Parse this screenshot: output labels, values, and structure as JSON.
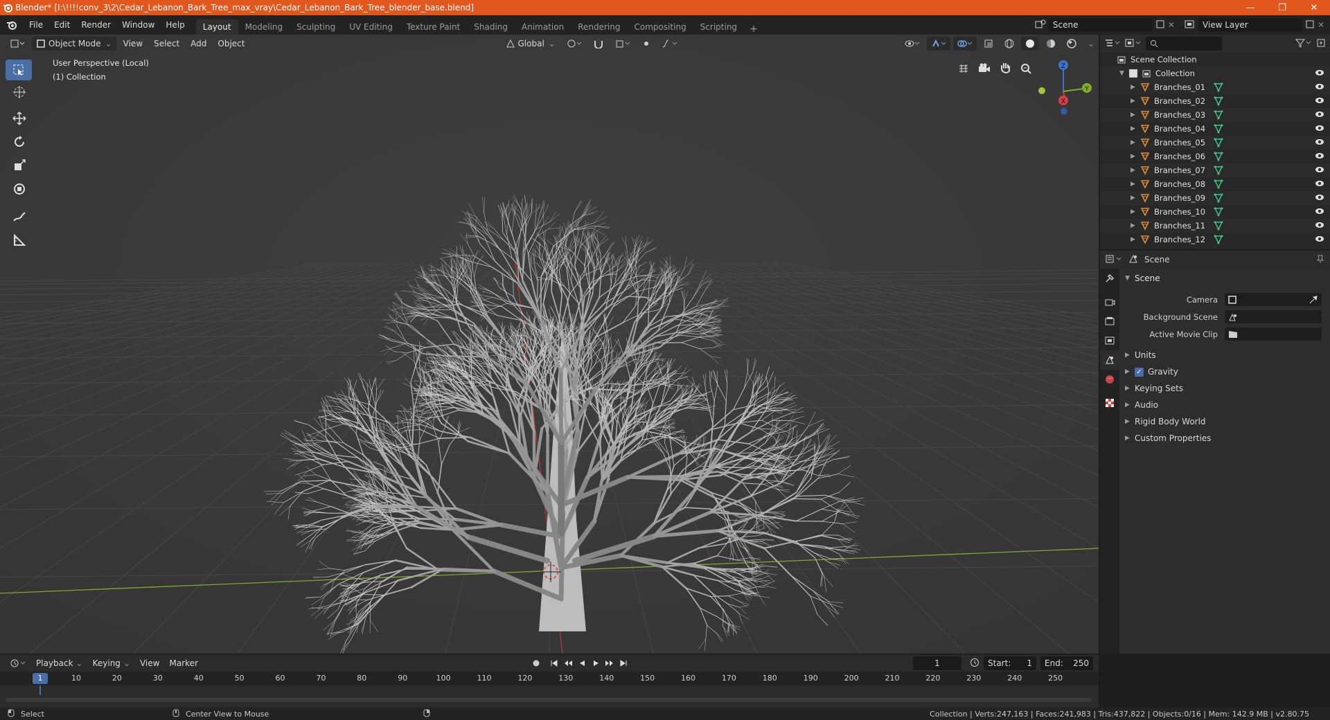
{
  "window": {
    "title": "Blender* [I:\\!!!!conv_3\\2\\Cedar_Lebanon_Bark_Tree_max_vray\\Cedar_Lebanon_Bark_Tree_blender_base.blend]",
    "minimize": "—",
    "maximize": "❐",
    "close": "✕"
  },
  "menu": [
    "File",
    "Edit",
    "Render",
    "Window",
    "Help"
  ],
  "workspaces": [
    "Layout",
    "Modeling",
    "Sculpting",
    "UV Editing",
    "Texture Paint",
    "Shading",
    "Animation",
    "Rendering",
    "Compositing",
    "Scripting"
  ],
  "workspace_add": "+",
  "scene_selector": "Scene",
  "view_layer": "View Layer",
  "viewport": {
    "mode": "Object Mode",
    "menus": [
      "View",
      "Select",
      "Add",
      "Object"
    ],
    "orientation": "Global",
    "overlay_line1": "User Perspective (Local)",
    "overlay_line2": "(1) Collection",
    "axes": {
      "x": "X",
      "y": "Y",
      "z": "Z"
    }
  },
  "outliner": {
    "root": "Scene Collection",
    "collection": "Collection",
    "items": [
      "Branches_01",
      "Branches_02",
      "Branches_03",
      "Branches_04",
      "Branches_05",
      "Branches_06",
      "Branches_07",
      "Branches_08",
      "Branches_09",
      "Branches_10",
      "Branches_11",
      "Branches_12"
    ]
  },
  "properties": {
    "context": "Scene",
    "panel_title": "Scene",
    "camera_label": "Camera",
    "background_label": "Background Scene",
    "movieclip_label": "Active Movie Clip",
    "subpanels": [
      "Units",
      "Gravity",
      "Keying Sets",
      "Audio",
      "Rigid Body World",
      "Custom Properties"
    ],
    "gravity_checked": true
  },
  "timeline": {
    "menus": [
      "Playback",
      "Keying",
      "View",
      "Marker"
    ],
    "current_frame": "1",
    "start_label": "Start:",
    "start": "1",
    "end_label": "End:",
    "end": "250",
    "ruler": [
      "10",
      "20",
      "30",
      "40",
      "50",
      "60",
      "70",
      "80",
      "90",
      "100",
      "110",
      "120",
      "130",
      "140",
      "150",
      "160",
      "170",
      "180",
      "190",
      "200",
      "210",
      "220",
      "230",
      "240",
      "250"
    ],
    "ruler_marker": "1"
  },
  "statusbar": {
    "select": "Select",
    "center": "Center View to Mouse",
    "stats": "Collection | Verts:247,163 | Faces:241,983 | Tris:437,822 | Objects:0/16 | Mem: 142.9 MB | v2.80.75"
  },
  "colors": {
    "title_bar": "#e2571e",
    "accent_blue": "#4a6fa5",
    "viewport_bg": "#393939",
    "mesh_orange": "#e08a3c",
    "mesh_data_green": "#42c98a",
    "axis_red": "#d43c46",
    "axis_green": "#7fab2a",
    "axis_blue": "#3c74c9"
  }
}
